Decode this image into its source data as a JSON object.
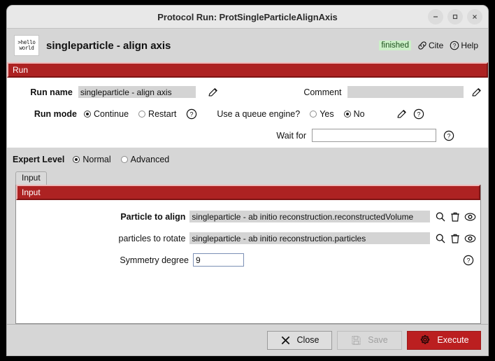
{
  "window": {
    "title": "Protocol Run: ProtSingleParticleAlignAxis",
    "minimize_label": "–",
    "maximize_label": "□",
    "close_label": "✕"
  },
  "header": {
    "logo_line1": ">hello",
    "logo_line2": "world",
    "protocol_name": "singleparticle - align axis",
    "status": "finished",
    "cite_label": "Cite",
    "help_label": "Help"
  },
  "run_section": {
    "title": "Run",
    "run_name_label": "Run name",
    "run_name_value": "singleparticle - align axis",
    "comment_label": "Comment",
    "comment_value": "",
    "run_mode_label": "Run mode",
    "run_mode_options": [
      "Continue",
      "Restart"
    ],
    "run_mode_selected": "Continue",
    "queue_label": "Use a queue engine?",
    "queue_options": [
      "Yes",
      "No"
    ],
    "queue_selected": "No",
    "wait_for_label": "Wait for",
    "wait_for_value": ""
  },
  "expert": {
    "label": "Expert Level",
    "options": [
      "Normal",
      "Advanced"
    ],
    "selected": "Normal"
  },
  "tabs": [
    {
      "label": "Input",
      "active": true
    }
  ],
  "input_section": {
    "title": "Input",
    "rows": [
      {
        "label": "Particle to align",
        "bold": true,
        "value": "singleparticle - ab initio reconstruction.reconstructedVolume",
        "type": "pointer",
        "icons": [
          "search-icon",
          "trash-icon",
          "eye-icon"
        ]
      },
      {
        "label": "particles to rotate",
        "bold": false,
        "value": "singleparticle - ab initio reconstruction.particles",
        "type": "pointer",
        "icons": [
          "search-icon",
          "trash-icon",
          "eye-icon"
        ]
      },
      {
        "label": "Symmetry degree",
        "bold": false,
        "value": "9",
        "type": "text",
        "icons": [
          "help-icon"
        ]
      }
    ]
  },
  "footer": {
    "close_label": "Close",
    "save_label": "Save",
    "execute_label": "Execute"
  },
  "colors": {
    "section_red": "#ad2222",
    "execute_red": "#bb1f20",
    "status_green_bg": "#ccf0c8",
    "window_gray": "#d6d6d6"
  }
}
